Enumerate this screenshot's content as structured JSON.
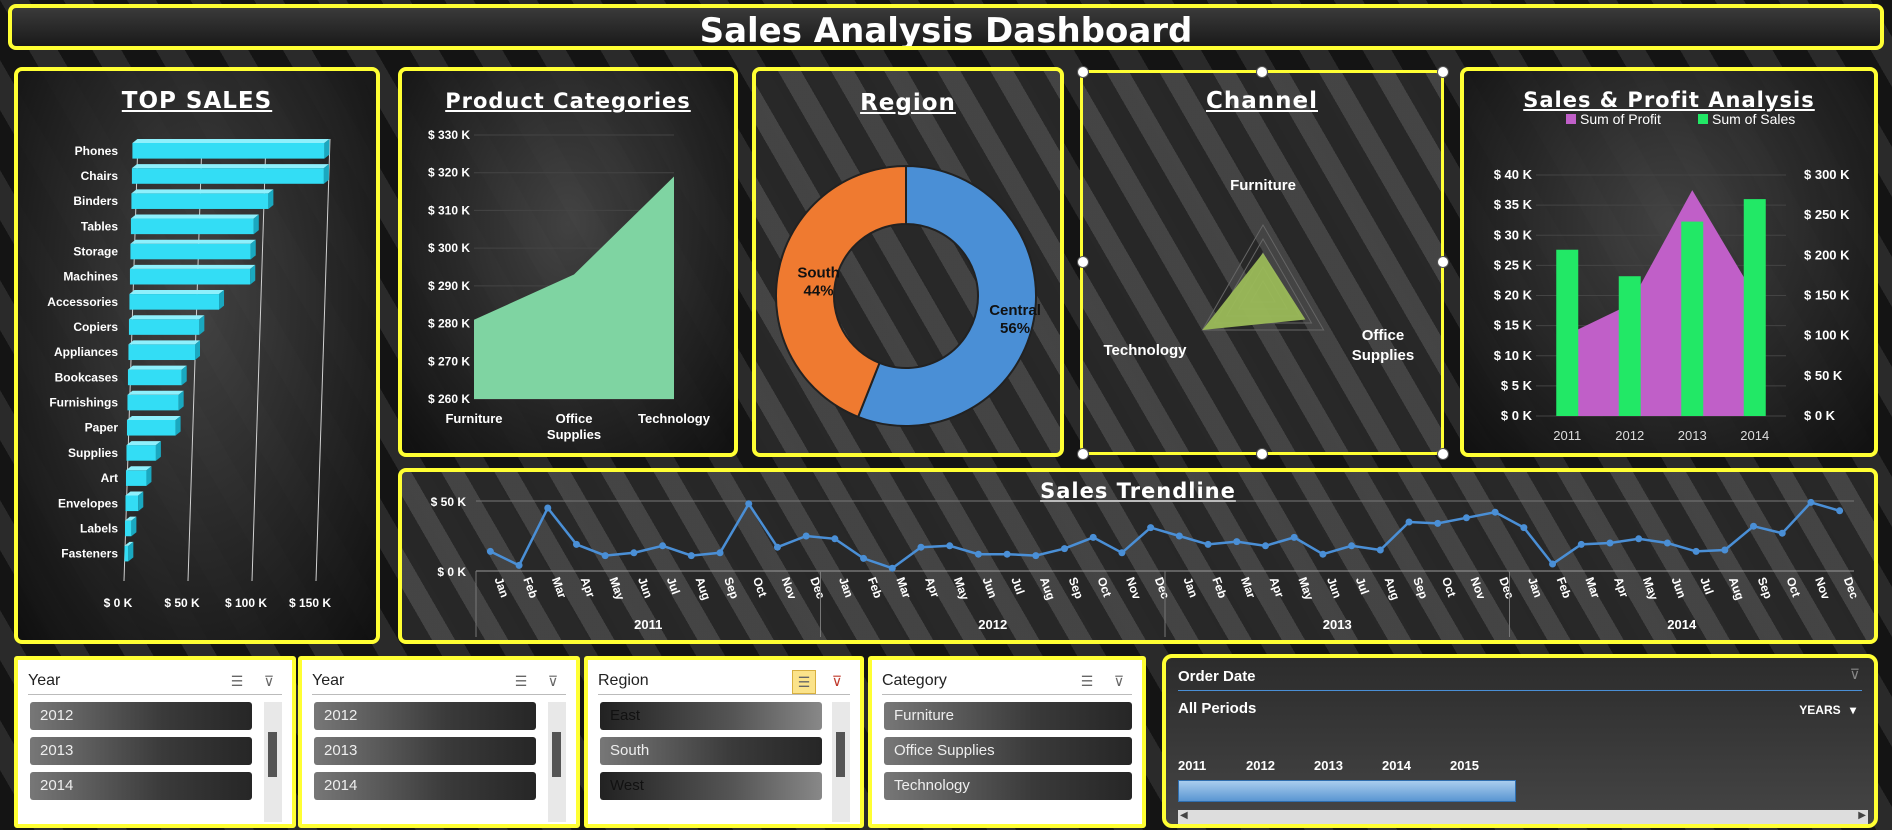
{
  "dashboard": {
    "title": "Sales Analysis Dashboard"
  },
  "top_sales": {
    "title": "TOP SALES",
    "chart_data": {
      "type": "bar",
      "orientation": "horizontal",
      "categories": [
        "Phones",
        "Chairs",
        "Binders",
        "Tables",
        "Storage",
        "Machines",
        "Accessories",
        "Copiers",
        "Appliances",
        "Bookcases",
        "Furnishings",
        "Paper",
        "Supplies",
        "Art",
        "Envelopes",
        "Labels",
        "Fasteners"
      ],
      "values": [
        150000,
        150000,
        107000,
        96000,
        94000,
        94000,
        70000,
        55000,
        52000,
        42000,
        40000,
        38000,
        23000,
        16000,
        10000,
        5000,
        3000
      ],
      "xlim": [
        0,
        150000
      ],
      "tick_labels": [
        "$ 0 K",
        "$ 50 K",
        "$ 100 K",
        "$ 150 K"
      ],
      "color": "#33ddf5"
    }
  },
  "product_categories": {
    "title": "Product Categories",
    "chart_data": {
      "type": "area",
      "categories": [
        "Furniture",
        "Office Supplies",
        "Technology"
      ],
      "values": [
        281000,
        293000,
        319000
      ],
      "ylim": [
        260000,
        330000
      ],
      "tick_labels": [
        "$ 260 K",
        "$ 270 K",
        "$ 280 K",
        "$ 290 K",
        "$ 300 K",
        "$ 310 K",
        "$ 320 K",
        "$ 330 K"
      ],
      "color": "#7fd4a2"
    }
  },
  "region": {
    "title": "Region",
    "chart_data": {
      "type": "pie",
      "donut": true,
      "slices": [
        {
          "label": "Central",
          "value": 56,
          "pct": "56%",
          "color": "#4a8fd6"
        },
        {
          "label": "South",
          "value": 44,
          "pct": "44%",
          "color": "#ef7a30"
        }
      ]
    }
  },
  "channel": {
    "title": "Channel",
    "chart_data": {
      "type": "radar",
      "axes": [
        "Furniture",
        "Office Supplies",
        "Technology"
      ],
      "axis_label_lines": [
        [
          "Furniture"
        ],
        [
          "Office",
          "Supplies"
        ],
        [
          "Technology"
        ]
      ],
      "values": [
        0.6,
        0.7,
        1.0
      ],
      "color": "#9bbb59"
    }
  },
  "sales_profit": {
    "title": "Sales & Profit Analysis",
    "legend": [
      {
        "label": "Sum of Profit",
        "color": "#c05fc8"
      },
      {
        "label": "Sum of Sales",
        "color": "#22e866"
      }
    ],
    "chart_data": {
      "type": "bar",
      "categories": [
        "2011",
        "2012",
        "2013",
        "2014"
      ],
      "series": [
        {
          "name": "Sum of Sales",
          "values": [
            207000,
            174000,
            242000,
            270000
          ],
          "axis": "right",
          "chart": "bar",
          "color": "#22e866"
        },
        {
          "name": "Sum of Profit",
          "values": [
            13500,
            18500,
            37500,
            20000
          ],
          "axis": "left",
          "chart": "area",
          "color": "#c05fc8"
        }
      ],
      "ylim_left": [
        0,
        40000
      ],
      "ylim_right": [
        0,
        300000
      ],
      "left_tick_labels": [
        "$ 0 K",
        "$ 5 K",
        "$ 10 K",
        "$ 15 K",
        "$ 20 K",
        "$ 25 K",
        "$ 30 K",
        "$ 35 K",
        "$ 40 K"
      ],
      "right_tick_labels": [
        "$ 0 K",
        "$ 50 K",
        "$ 100 K",
        "$ 150 K",
        "$ 200 K",
        "$ 250 K",
        "$ 300 K"
      ]
    }
  },
  "trendline": {
    "title": "Sales Trendline",
    "chart_data": {
      "type": "line",
      "months": [
        "Jan",
        "Feb",
        "Mar",
        "Apr",
        "May",
        "Jun",
        "Jul",
        "Aug",
        "Sep",
        "Oct",
        "Nov",
        "Dec"
      ],
      "years": [
        "2011",
        "2012",
        "2013",
        "2014"
      ],
      "values": [
        14000,
        4000,
        45000,
        19000,
        11000,
        13000,
        18000,
        11000,
        13000,
        48000,
        17000,
        25000,
        23000,
        9000,
        2000,
        17000,
        18000,
        12000,
        12000,
        11000,
        16000,
        24000,
        13000,
        31000,
        25000,
        19000,
        21000,
        18000,
        24000,
        12000,
        18000,
        15000,
        35000,
        34000,
        38000,
        42000,
        31000,
        5000,
        19000,
        20000,
        23000,
        20000,
        14000,
        15000,
        32000,
        27000,
        49000,
        43000
      ],
      "ylim": [
        0,
        50000
      ],
      "tick_labels": [
        "$ 0 K",
        "$ 50 K"
      ],
      "color": "#4a8fd6"
    }
  },
  "slicers": {
    "year1": {
      "header": "Year",
      "items": [
        "2012",
        "2013",
        "2014"
      ]
    },
    "year2": {
      "header": "Year",
      "items": [
        "2012",
        "2013",
        "2014"
      ]
    },
    "region": {
      "header": "Region",
      "items": [
        "East",
        "South",
        "West"
      ]
    },
    "category": {
      "header": "Category",
      "items": [
        "Furniture",
        "Office Supplies",
        "Technology"
      ]
    },
    "order_date": {
      "header": "Order Date",
      "period": "All Periods",
      "level": "YEARS",
      "years": [
        "2011",
        "2012",
        "2013",
        "2014",
        "2015"
      ]
    }
  }
}
